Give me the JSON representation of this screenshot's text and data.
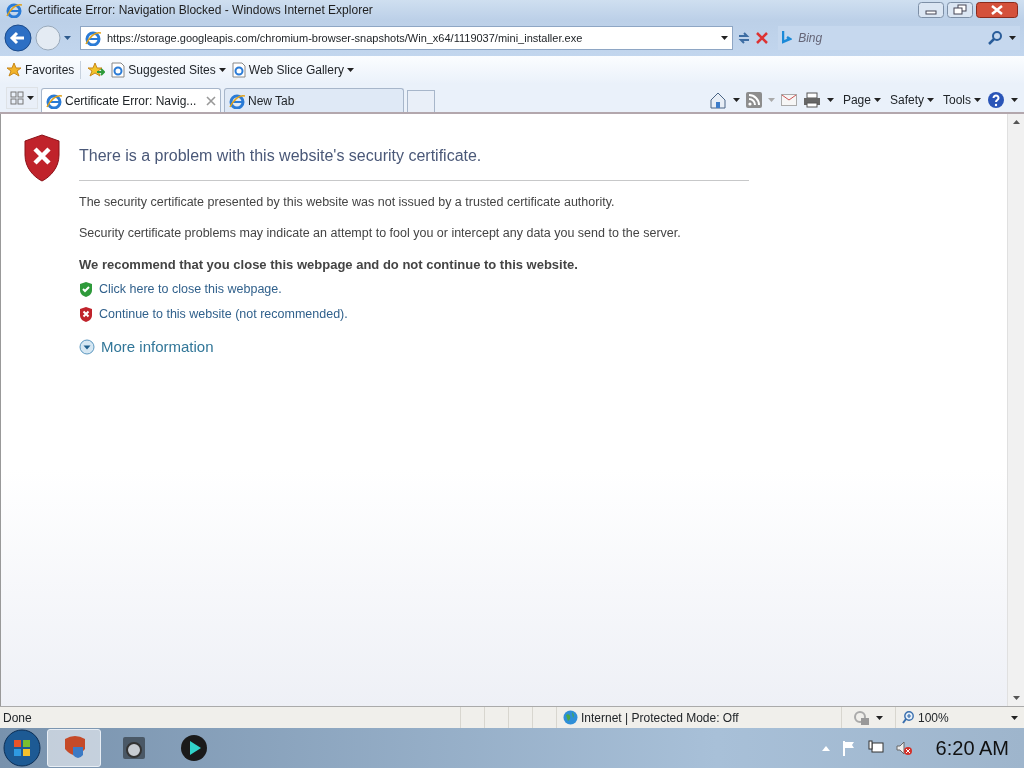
{
  "window": {
    "title": "Certificate Error: Navigation Blocked - Windows Internet Explorer"
  },
  "address": {
    "url": "https://storage.googleapis.com/chromium-browser-snapshots/Win_x64/1119037/mini_installer.exe"
  },
  "search": {
    "placeholder": "Bing"
  },
  "favorites_bar": {
    "label": "Favorites",
    "links": [
      {
        "label": "Suggested Sites"
      },
      {
        "label": "Web Slice Gallery"
      }
    ]
  },
  "tabs": [
    {
      "label": "Certificate Error: Navig...",
      "selected": true
    },
    {
      "label": "New Tab",
      "selected": false
    }
  ],
  "command_bar": [
    "Page",
    "Safety",
    "Tools"
  ],
  "content": {
    "heading": "There is a problem with this website's security certificate.",
    "paragraphs": [
      "The security certificate presented by this website was not issued by a trusted certificate authority.",
      "Security certificate problems may indicate an attempt to fool you or intercept any data you send to the server."
    ],
    "recommendation": "We recommend that you close this webpage and do not continue to this website.",
    "links": [
      {
        "kind": "close",
        "label": "Click here to close this webpage."
      },
      {
        "kind": "continue",
        "label": "Continue to this website (not recommended)."
      }
    ],
    "more_info": {
      "label": "More information",
      "expanded": false
    }
  },
  "status_bar": {
    "status": "Done",
    "zone": "Internet | Protected Mode: Off",
    "zoom": "100%"
  },
  "taskbar": {
    "clock": "6:20 AM",
    "pinned": [
      {
        "selected": true
      },
      {
        "selected": false
      },
      {
        "selected": false
      }
    ]
  }
}
